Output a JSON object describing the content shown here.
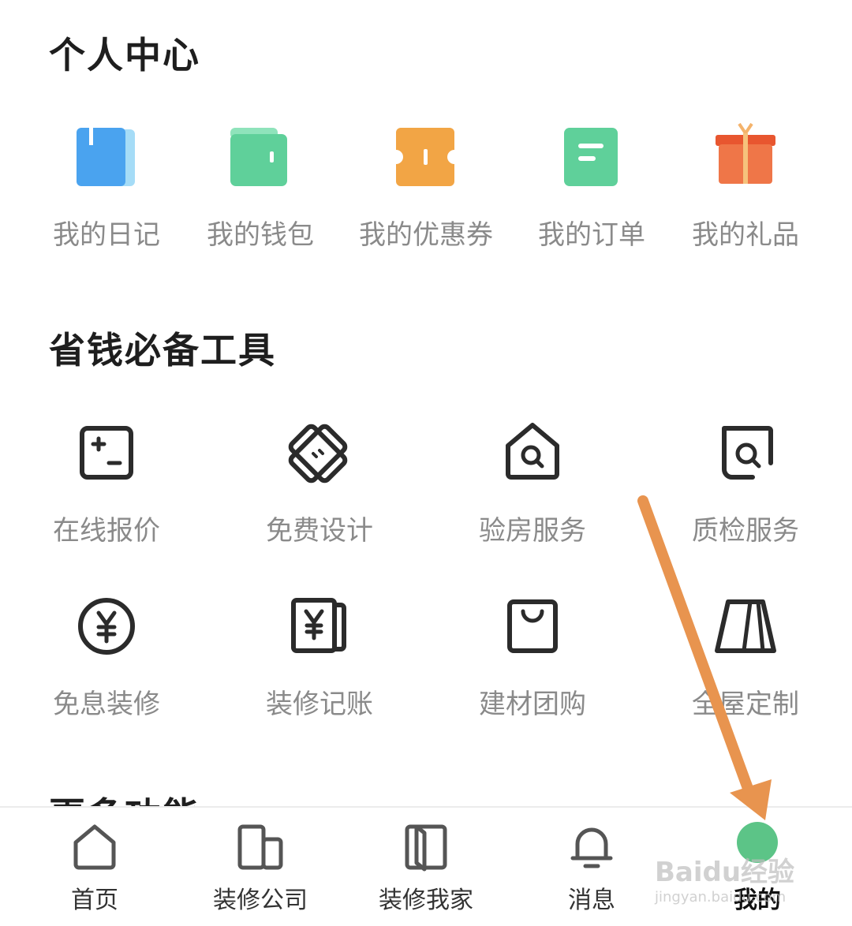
{
  "personal_center": {
    "title": "个人中心",
    "items": [
      {
        "label": "我的日记",
        "icon": "diary-icon",
        "color": "#4aa3ef"
      },
      {
        "label": "我的钱包",
        "icon": "wallet-icon",
        "color": "#5fd09a"
      },
      {
        "label": "我的优惠券",
        "icon": "coupon-icon",
        "color": "#f2a545"
      },
      {
        "label": "我的订单",
        "icon": "order-icon",
        "color": "#5fd09a"
      },
      {
        "label": "我的礼品",
        "icon": "gift-icon",
        "color": "#ee6b43"
      }
    ]
  },
  "tools": {
    "title": "省钱必备工具",
    "items": [
      {
        "label": "在线报价",
        "icon": "calculator-icon"
      },
      {
        "label": "免费设计",
        "icon": "design-ruler-icon"
      },
      {
        "label": "验房服务",
        "icon": "house-inspect-icon"
      },
      {
        "label": "质检服务",
        "icon": "quality-check-icon"
      },
      {
        "label": "免息装修",
        "icon": "yuan-coin-icon"
      },
      {
        "label": "装修记账",
        "icon": "ledger-icon"
      },
      {
        "label": "建材团购",
        "icon": "shopping-bag-icon"
      },
      {
        "label": "全屋定制",
        "icon": "wardrobe-icon"
      }
    ]
  },
  "more": {
    "title": "更多功能"
  },
  "tabbar": {
    "items": [
      {
        "label": "首页",
        "icon": "home-icon"
      },
      {
        "label": "装修公司",
        "icon": "company-icon"
      },
      {
        "label": "装修我家",
        "icon": "my-home-icon"
      },
      {
        "label": "消息",
        "icon": "bell-icon"
      },
      {
        "label": "我的",
        "icon": "profile-dot-icon",
        "active": true
      }
    ],
    "active_color": "#5cc487"
  },
  "annotation": {
    "arrow_color": "#e8944f"
  },
  "watermark": {
    "text": "Baidu经验",
    "sub": "jingyan.baidu.com"
  }
}
